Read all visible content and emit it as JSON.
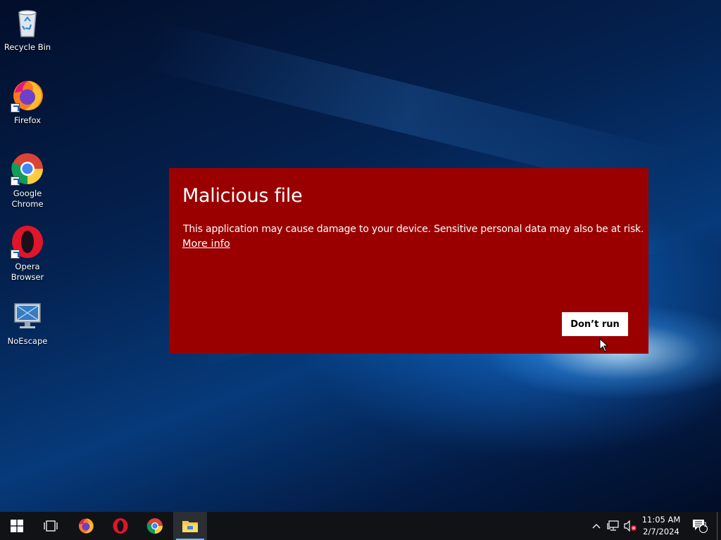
{
  "desktop": {
    "icons": [
      {
        "label": "Recycle Bin",
        "icon": "recycle-bin-icon"
      },
      {
        "label": "Firefox",
        "icon": "firefox-icon"
      },
      {
        "label": "Google Chrome",
        "icon": "chrome-icon"
      },
      {
        "label": "Opera Browser",
        "icon": "opera-icon"
      },
      {
        "label": "NoEscape",
        "icon": "noescape-icon"
      }
    ]
  },
  "dialog": {
    "title": "Malicious file",
    "message": "This application may cause damage to your device. Sensitive personal data may also be at risk.",
    "link": "More info",
    "button": "Don’t run",
    "background_color": "#9b0000"
  },
  "taskbar": {
    "items": [
      "start-icon",
      "task-view-icon",
      "firefox-icon",
      "opera-icon",
      "chrome-icon",
      "file-explorer-icon"
    ],
    "active_item": "file-explorer-icon",
    "tray_icons": [
      "chevron-up-icon",
      "network-icon",
      "volume-muted-icon"
    ],
    "clock": {
      "time": "11:05 AM",
      "date": "2/7/2024"
    },
    "notification_count": "1"
  }
}
